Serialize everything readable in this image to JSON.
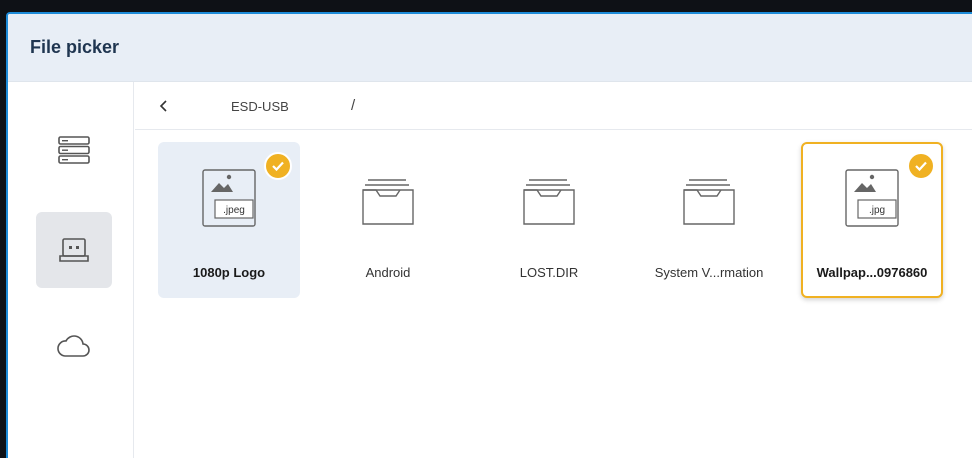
{
  "window": {
    "title": "File picker"
  },
  "sidebar": {
    "items": [
      {
        "name": "storage-list",
        "icon": "storage-list-icon",
        "active": false
      },
      {
        "name": "usb",
        "icon": "usb-drive-icon",
        "active": true
      },
      {
        "name": "cloud",
        "icon": "cloud-icon",
        "active": false
      }
    ]
  },
  "path": {
    "back": "<",
    "root": "ESD-USB",
    "separator": "/"
  },
  "files": [
    {
      "label": "1080p Logo",
      "type": "image",
      "ext": ".jpeg",
      "checked": true,
      "state": "selected"
    },
    {
      "label": "Android",
      "type": "folder",
      "checked": false,
      "state": "normal"
    },
    {
      "label": "LOST.DIR",
      "type": "folder",
      "checked": false,
      "state": "normal"
    },
    {
      "label": "System V...rmation",
      "type": "folder",
      "checked": false,
      "state": "normal"
    },
    {
      "label": "Wallpap...0976860",
      "type": "image",
      "ext": ".jpg",
      "checked": true,
      "state": "focused"
    }
  ],
  "colors": {
    "accent": "#f0b122",
    "border": "#1d8bd8",
    "titlebar": "#e8eef6"
  }
}
